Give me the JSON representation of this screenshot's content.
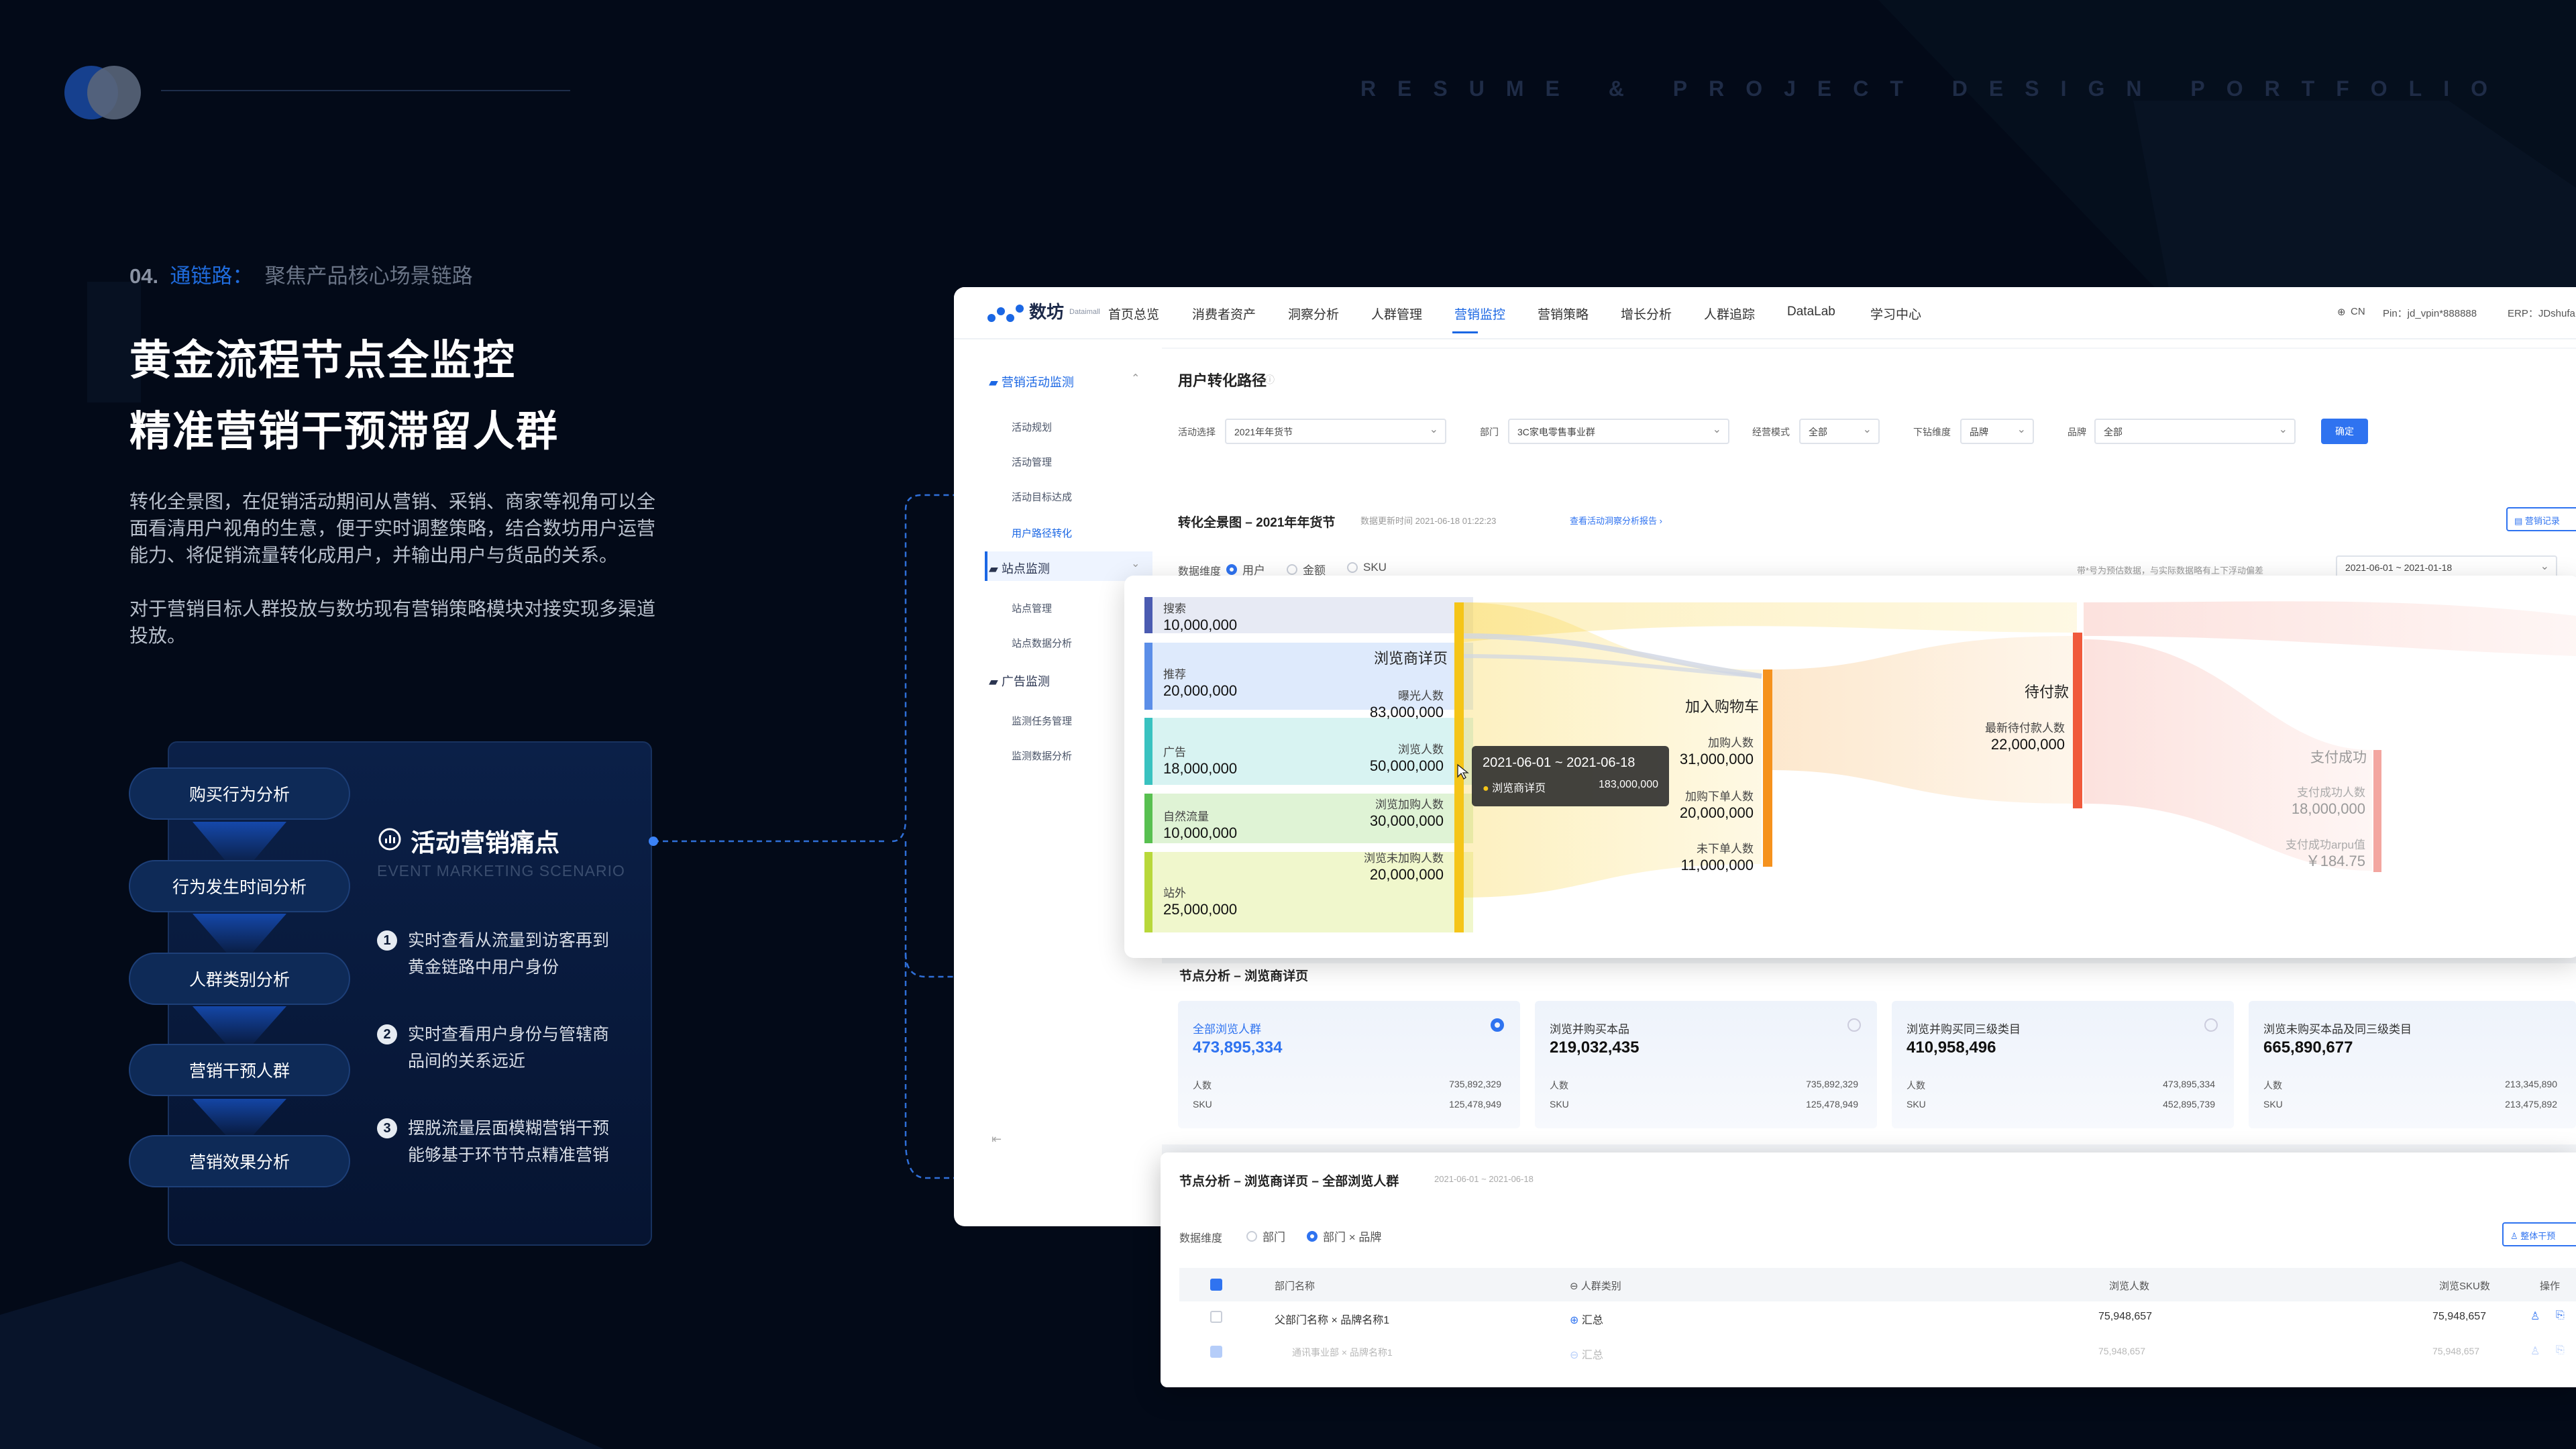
{
  "header": {
    "portfolio_label": "RESUME & PROJECT DESIGN PORTFOLIO"
  },
  "section": {
    "number": "04.",
    "highlight": "通链路：",
    "rest": "聚焦产品核心场景链路"
  },
  "headline": {
    "line1": "黄金流程节点全监控",
    "line2": "精准营销干预滞留人群"
  },
  "paragraphs": [
    "转化全景图，在促销活动期间从营销、采销、商家等视角可以全面看清用户视角的生意，便于实时调整策略，结合数坊用户运营能力、将促销流量转化成用户，并输出用户与货品的关系。",
    "对于营销目标人群投放与数坊现有营销策略模块对接实现多渠道投放。"
  ],
  "flow_steps": [
    "购买行为分析",
    "行为发生时间分析",
    "人群类别分析",
    "营销干预人群",
    "营销效果分析"
  ],
  "pain": {
    "title": "活动营销痛点",
    "subtitle": "EVENT MARKETING SCENARIO",
    "items": [
      {
        "num": "1",
        "line1": "实时查看从流量到访客再到",
        "line2": "黄金链路中用户身份"
      },
      {
        "num": "2",
        "line1": "实时查看用户身份与管辖商",
        "line2": "品间的关系远近"
      },
      {
        "num": "3",
        "line1": "摆脱流量层面模糊营销干预",
        "line2": "能够基于环节节点精准营销"
      }
    ]
  },
  "app": {
    "brand": {
      "name": "数坊",
      "sub": "Dataimall"
    },
    "nav": [
      "首页总览",
      "消费者资产",
      "洞察分析",
      "人群管理",
      "营销监控",
      "营销策略",
      "增长分析",
      "人群追踪",
      "DataLab",
      "学习中心"
    ],
    "nav_right": {
      "lang": "CN",
      "pin": "Pin：jd_vpin*888888",
      "erp": "ERP：JDshufa"
    },
    "sidebar": {
      "group1": "营销活动监测",
      "group1_items": [
        "活动规划",
        "活动管理",
        "活动目标达成",
        "用户路径转化"
      ],
      "group2": "站点监测",
      "group2_items": [
        "站点管理",
        "站点数据分析"
      ],
      "group3": "广告监测",
      "group3_items": [
        "监测任务管理",
        "监测数据分析"
      ]
    },
    "page_title": "用户转化路径",
    "filters": {
      "activity_label": "活动选择",
      "activity_value": "2021年年货节",
      "dept_label": "部门",
      "dept_value": "3C家电零售事业群",
      "mode_label": "经营模式",
      "mode_value": "全部",
      "drill_label": "下钻维度",
      "drill_value": "品牌",
      "brand_label": "品牌",
      "brand_value": "全部",
      "confirm": "确定"
    },
    "overview": {
      "title": "转化全景图 – 2021年年货节",
      "updated": "数据更新时间  2021-06-18  01:22:23",
      "report_link": "查看活动洞察分析报告 ›",
      "record_btn": "营销记录",
      "dim_label": "数据维度",
      "dims": [
        "用户",
        "金额",
        "SKU"
      ],
      "note": "带*号为预估数据，与实际数据略有上下浮动偏差",
      "date_range": "2021-06-01 ~ 2021-01-18"
    },
    "sankey": {
      "sources": [
        {
          "name": "搜索",
          "value": "10,000,000"
        },
        {
          "name": "推荐",
          "value": "20,000,000"
        },
        {
          "name": "广告",
          "value": "18,000,000"
        },
        {
          "name": "自然流量",
          "value": "10,000,000"
        },
        {
          "name": "站外",
          "value": "25,000,000"
        }
      ],
      "browse_node": "浏览商详页",
      "browse_metrics": [
        {
          "name": "曝光人数",
          "value": "83,000,000"
        },
        {
          "name": "浏览人数",
          "value": "50,000,000"
        },
        {
          "name": "浏览加购人数",
          "value": "30,000,000"
        },
        {
          "name": "浏览未加购人数",
          "value": "20,000,000"
        }
      ],
      "cart_node": "加入购物车",
      "cart_metrics": [
        {
          "name": "加购人数",
          "value": "31,000,000"
        },
        {
          "name": "加购下单人数",
          "value": "20,000,000"
        },
        {
          "name": "未下单人数",
          "value": "11,000,000"
        }
      ],
      "pay_node": "待付款",
      "pay_metric": {
        "name": "最新待付款人数",
        "value": "22,000,000"
      },
      "success_node": "支付成功",
      "success_metrics": [
        {
          "name": "支付成功人数",
          "value": "18,000,000"
        },
        {
          "name": "支付成功arpu值",
          "value": "￥184.75"
        }
      ],
      "tooltip": {
        "date": "2021-06-01 ~ 2021-06-18",
        "label": "浏览商详页",
        "value": "183,000,000"
      }
    },
    "node_analysis": {
      "title": "节点分析 – 浏览商详页",
      "cards": [
        {
          "title": "全部浏览人群",
          "value": "473,895,334",
          "r1_label": "人数",
          "r1_value": "735,892,329",
          "r2_label": "SKU",
          "r2_value": "125,478,949",
          "selected": true
        },
        {
          "title": "浏览并购买本品",
          "value": "219,032,435",
          "r1_label": "人数",
          "r1_value": "735,892,329",
          "r2_label": "SKU",
          "r2_value": "125,478,949"
        },
        {
          "title": "浏览并购买同三级类目",
          "value": "410,958,496",
          "r1_label": "人数",
          "r1_value": "473,895,334",
          "r2_label": "SKU",
          "r2_value": "452,895,739"
        },
        {
          "title": "浏览未购买本品及同三级类目",
          "value": "665,890,677",
          "r1_label": "人数",
          "r1_value": "213,345,890",
          "r2_label": "SKU",
          "r2_value": "213,475,892"
        }
      ]
    },
    "table_section": {
      "title": "节点分析 – 浏览商详页 – 全部浏览人群",
      "date": "2021-06-01 ~ 2021-06-18",
      "dim_label": "数据维度",
      "dims": [
        "部门",
        "部门 × 品牌"
      ],
      "action_btn": "整体干预",
      "headers": [
        "部门名称",
        "人群类别",
        "浏览人数",
        "浏览SKU数",
        "操作"
      ],
      "rows": [
        {
          "dept": "父部门名称 × 品牌名称1",
          "type": "汇总",
          "users": "75,948,657",
          "sku": "75,948,657"
        },
        {
          "dept": "通讯事业部 × 品牌名称1",
          "type": "汇总",
          "users": "75,948,657",
          "sku": "75,948,657"
        }
      ]
    }
  },
  "colors": {
    "accent": "#1b67e4",
    "background": "#030a18",
    "sankey_yellow": "#f5c518",
    "sankey_orange": "#f5921e",
    "sankey_red": "#f05a3c"
  }
}
